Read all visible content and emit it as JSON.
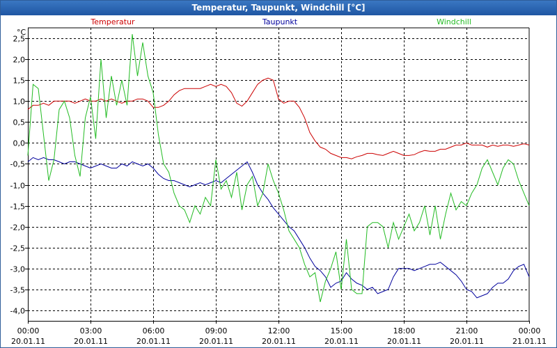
{
  "title": "Temperatur, Taupunkt, Windchill [°C]",
  "chart_data": {
    "type": "line",
    "title": "Temperatur, Taupunkt, Windchill [°C]",
    "ylabel": "°C",
    "ylim": [
      -4.25,
      2.75
    ],
    "yticks": [
      2.5,
      2.0,
      1.5,
      1.0,
      0.5,
      0.0,
      -0.5,
      -1.0,
      -1.5,
      -2.0,
      -2.5,
      -3.0,
      -3.5,
      -4.0
    ],
    "ytick_labels": [
      "2,5",
      "2,0",
      "1,5",
      "1,0",
      "0,5",
      "0,0",
      "-0,5",
      "-1,0",
      "-1,5",
      "-2,0",
      "-2,5",
      "-3,0",
      "-3,5",
      "-4,0"
    ],
    "xlim_hours": [
      0,
      24
    ],
    "xticks": [
      {
        "time": "00:00",
        "date": "20.01.11"
      },
      {
        "time": "03:00",
        "date": "20.01.11"
      },
      {
        "time": "06:00",
        "date": "20.01.11"
      },
      {
        "time": "09:00",
        "date": "20.01.11"
      },
      {
        "time": "12:00",
        "date": "20.01.11"
      },
      {
        "time": "15:00",
        "date": "20.01.11"
      },
      {
        "time": "18:00",
        "date": "20.01.11"
      },
      {
        "time": "21:00",
        "date": "20.01.11"
      },
      {
        "time": "00:00",
        "date": "21.01.11"
      }
    ],
    "grid": true,
    "legend_position": "top",
    "series": [
      {
        "name": "Temperatur",
        "color": "#cc0000",
        "x": [
          0,
          0.25,
          0.5,
          0.75,
          1,
          1.25,
          1.5,
          1.75,
          2,
          2.25,
          2.5,
          2.75,
          3,
          3.25,
          3.5,
          3.75,
          4,
          4.25,
          4.5,
          4.75,
          5,
          5.25,
          5.5,
          5.75,
          6,
          6.25,
          6.5,
          6.75,
          7,
          7.25,
          7.5,
          7.75,
          8,
          8.25,
          8.5,
          8.75,
          9,
          9.25,
          9.5,
          9.75,
          10,
          10.25,
          10.5,
          10.75,
          11,
          11.25,
          11.5,
          11.75,
          12,
          12.25,
          12.5,
          12.75,
          13,
          13.25,
          13.5,
          13.75,
          14,
          14.25,
          14.5,
          14.75,
          15,
          15.25,
          15.5,
          15.75,
          16,
          16.25,
          16.5,
          16.75,
          17,
          17.25,
          17.5,
          17.75,
          18,
          18.25,
          18.5,
          18.75,
          19,
          19.25,
          19.5,
          19.75,
          20,
          20.25,
          20.5,
          20.75,
          21,
          21.25,
          21.5,
          21.75,
          22,
          22.25,
          22.5,
          22.75,
          23,
          23.25,
          23.5,
          23.75,
          24
        ],
        "y": [
          0.8,
          0.9,
          0.9,
          0.95,
          0.9,
          1.0,
          1.0,
          1.0,
          1.0,
          0.95,
          1.0,
          1.05,
          1.0,
          1.0,
          1.05,
          1.0,
          1.05,
          1.0,
          0.95,
          1.0,
          1.0,
          1.05,
          1.05,
          1.0,
          0.85,
          0.85,
          0.9,
          1.0,
          1.15,
          1.25,
          1.3,
          1.3,
          1.3,
          1.3,
          1.35,
          1.4,
          1.35,
          1.4,
          1.35,
          1.2,
          0.95,
          0.88,
          1.0,
          1.2,
          1.4,
          1.5,
          1.55,
          1.5,
          1.05,
          0.95,
          1.0,
          1.0,
          0.85,
          0.6,
          0.25,
          0.05,
          -0.1,
          -0.15,
          -0.25,
          -0.3,
          -0.35,
          -0.35,
          -0.38,
          -0.33,
          -0.3,
          -0.25,
          -0.25,
          -0.28,
          -0.3,
          -0.25,
          -0.2,
          -0.25,
          -0.3,
          -0.3,
          -0.28,
          -0.22,
          -0.18,
          -0.2,
          -0.2,
          -0.15,
          -0.15,
          -0.1,
          -0.05,
          -0.05,
          0.0,
          -0.05,
          -0.05,
          -0.05,
          -0.1,
          -0.05,
          -0.08,
          -0.05,
          -0.05,
          -0.08,
          -0.05,
          -0.02,
          -0.05
        ]
      },
      {
        "name": "Taupunkt",
        "color": "#00009c",
        "x": [
          0,
          0.25,
          0.5,
          0.75,
          1,
          1.25,
          1.5,
          1.75,
          2,
          2.25,
          2.5,
          2.75,
          3,
          3.25,
          3.5,
          3.75,
          4,
          4.25,
          4.5,
          4.75,
          5,
          5.25,
          5.5,
          5.75,
          6,
          6.25,
          6.5,
          6.75,
          7,
          7.25,
          7.5,
          7.75,
          8,
          8.25,
          8.5,
          8.75,
          9,
          9.25,
          9.5,
          9.75,
          10,
          10.25,
          10.5,
          10.75,
          11,
          11.25,
          11.5,
          11.75,
          12,
          12.25,
          12.5,
          12.75,
          13,
          13.25,
          13.5,
          13.75,
          14,
          14.25,
          14.5,
          14.75,
          15,
          15.25,
          15.5,
          15.75,
          16,
          16.25,
          16.5,
          16.75,
          17,
          17.25,
          17.5,
          17.75,
          18,
          18.25,
          18.5,
          18.75,
          19,
          19.25,
          19.5,
          19.75,
          20,
          20.25,
          20.5,
          20.75,
          21,
          21.25,
          21.5,
          21.75,
          22,
          22.25,
          22.5,
          22.75,
          23,
          23.25,
          23.5,
          23.75,
          24
        ],
        "y": [
          -0.45,
          -0.35,
          -0.4,
          -0.35,
          -0.4,
          -0.4,
          -0.45,
          -0.5,
          -0.45,
          -0.45,
          -0.5,
          -0.55,
          -0.6,
          -0.55,
          -0.5,
          -0.55,
          -0.6,
          -0.6,
          -0.5,
          -0.55,
          -0.45,
          -0.5,
          -0.55,
          -0.5,
          -0.6,
          -0.75,
          -0.85,
          -0.9,
          -0.9,
          -0.95,
          -1.0,
          -1.05,
          -1.0,
          -0.95,
          -1.0,
          -0.95,
          -0.9,
          -0.95,
          -0.85,
          -0.75,
          -0.65,
          -0.55,
          -0.45,
          -0.7,
          -1.0,
          -1.2,
          -1.35,
          -1.55,
          -1.7,
          -1.85,
          -2.0,
          -2.1,
          -2.3,
          -2.5,
          -2.75,
          -2.95,
          -3.05,
          -3.2,
          -3.45,
          -3.35,
          -3.3,
          -3.1,
          -3.25,
          -3.35,
          -3.4,
          -3.5,
          -3.45,
          -3.6,
          -3.55,
          -3.5,
          -3.2,
          -3.0,
          -3.0,
          -3.0,
          -3.05,
          -3.0,
          -2.95,
          -2.9,
          -2.9,
          -2.85,
          -2.95,
          -3.05,
          -3.15,
          -3.3,
          -3.5,
          -3.55,
          -3.7,
          -3.65,
          -3.6,
          -3.45,
          -3.35,
          -3.35,
          -3.25,
          -3.05,
          -2.95,
          -2.9,
          -3.2
        ]
      },
      {
        "name": "Windchill",
        "color": "#22bb22",
        "x": [
          0,
          0.25,
          0.5,
          0.75,
          1,
          1.25,
          1.5,
          1.75,
          2,
          2.25,
          2.5,
          2.75,
          3,
          3.25,
          3.5,
          3.75,
          4,
          4.25,
          4.5,
          4.75,
          5,
          5.25,
          5.5,
          5.75,
          6,
          6.25,
          6.5,
          6.75,
          7,
          7.25,
          7.5,
          7.75,
          8,
          8.25,
          8.5,
          8.75,
          9,
          9.25,
          9.5,
          9.75,
          10,
          10.25,
          10.5,
          10.75,
          11,
          11.25,
          11.5,
          11.75,
          12,
          12.25,
          12.5,
          12.75,
          13,
          13.25,
          13.5,
          13.75,
          14,
          14.25,
          14.5,
          14.75,
          15,
          15.25,
          15.5,
          15.75,
          16,
          16.25,
          16.5,
          16.75,
          17,
          17.25,
          17.5,
          17.75,
          18,
          18.25,
          18.5,
          18.75,
          19,
          19.25,
          19.5,
          19.75,
          20,
          20.25,
          20.5,
          20.75,
          21,
          21.25,
          21.5,
          21.75,
          22,
          22.25,
          22.5,
          22.75,
          23,
          23.25,
          23.5,
          23.75,
          24
        ],
        "y": [
          -0.3,
          1.4,
          1.3,
          0.2,
          -0.9,
          -0.4,
          0.8,
          1.0,
          0.6,
          -0.3,
          -0.8,
          0.6,
          1.1,
          0.1,
          2.0,
          0.6,
          1.6,
          0.9,
          1.5,
          0.9,
          2.6,
          1.6,
          2.4,
          1.6,
          1.2,
          0.2,
          -0.5,
          -0.7,
          -1.2,
          -1.5,
          -1.6,
          -1.9,
          -1.5,
          -1.7,
          -1.3,
          -1.5,
          -0.4,
          -1.1,
          -0.9,
          -1.3,
          -0.7,
          -1.6,
          -1.0,
          -0.8,
          -1.5,
          -1.2,
          -0.5,
          -0.9,
          -1.2,
          -1.6,
          -2.1,
          -2.3,
          -2.5,
          -2.9,
          -3.2,
          -3.1,
          -3.8,
          -3.3,
          -3.0,
          -2.6,
          -3.5,
          -2.3,
          -3.5,
          -3.6,
          -3.6,
          -2.0,
          -1.9,
          -1.9,
          -2.0,
          -2.5,
          -1.9,
          -2.3,
          -2.0,
          -1.7,
          -2.1,
          -1.9,
          -1.5,
          -2.2,
          -1.5,
          -2.3,
          -1.7,
          -1.2,
          -1.6,
          -1.4,
          -1.5,
          -1.2,
          -1.0,
          -0.6,
          -0.4,
          -0.7,
          -1.0,
          -0.6,
          -0.4,
          -0.5,
          -0.9,
          -1.2,
          -1.5
        ]
      }
    ]
  }
}
